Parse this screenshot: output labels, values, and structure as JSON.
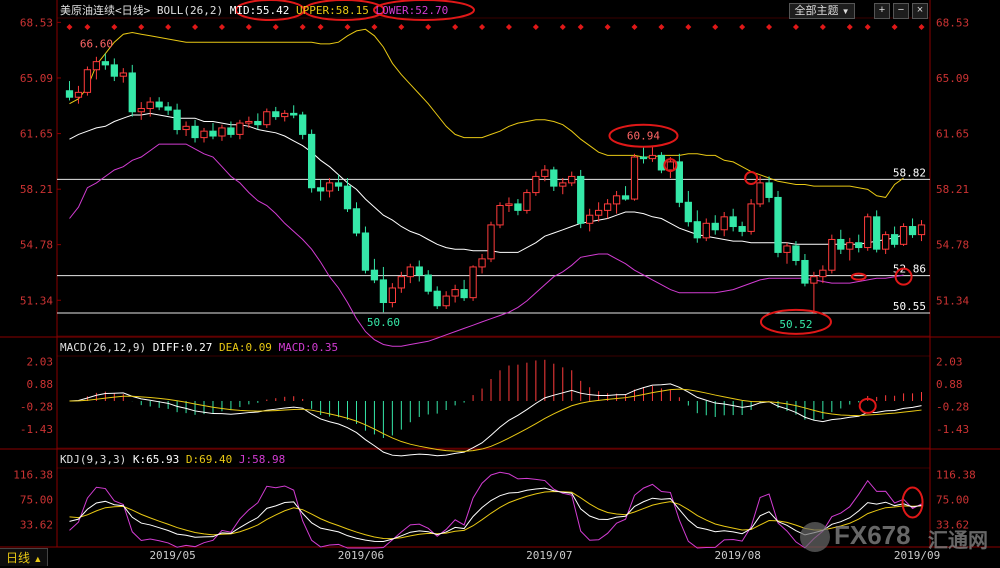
{
  "header": {
    "instrument": "美原油连续",
    "period": "<日线>",
    "boll_label": "BOLL(26,2)",
    "mid": "MID:55.42",
    "upper": "UPPER:58.15",
    "lower": "LOWER:52.70",
    "theme_button": "全部主题",
    "colors": {
      "mid": "#ffffff",
      "upper": "#e8c814",
      "lower": "#d23cd2"
    }
  },
  "bottom_bar": {
    "period_tab": "日线",
    "arrow": "▲"
  },
  "watermark": {
    "logo": "FX678",
    "cn": "汇通网"
  },
  "chart_data": [
    {
      "type": "candlestick",
      "name": "price",
      "ylim": [
        49.5,
        68.8
      ],
      "y_ticks": [
        "68.53",
        "65.09",
        "61.65",
        "58.21",
        "54.78",
        "51.34"
      ],
      "horizontal_lines": [
        {
          "value": 58.82,
          "label": "58.82"
        },
        {
          "value": 52.86,
          "label": "52.86"
        },
        {
          "value": 50.55,
          "label": "50.55"
        }
      ],
      "price_annotations": [
        "66.60",
        "60.94",
        "50.60",
        "50.52",
        "58.82"
      ],
      "x_labels": [
        "2019/05",
        "2019/06",
        "2019/07",
        "2019/08",
        "2019/09"
      ],
      "series": [
        {
          "name": "UPPER",
          "values": [
            63.5,
            63.8,
            64.5,
            65.9,
            66.6,
            67.3,
            67.8,
            67.9,
            67.8,
            67.7,
            67.6,
            67.5,
            67.4,
            67.3,
            67.3,
            67.3,
            67.3,
            67.3,
            67.3,
            67.3,
            67.3,
            67.3,
            67.3,
            67.3,
            67.3,
            67.3,
            67.3,
            67.3,
            67.2,
            67.2,
            67.3,
            67.7,
            68.0,
            68.1,
            67.7,
            67.0,
            66.0,
            65.3,
            64.7,
            64.1,
            63.5,
            62.8,
            62.1,
            61.6,
            61.4,
            61.4,
            61.4,
            61.6,
            61.8,
            62.1,
            62.3,
            62.4,
            62.5,
            62.5,
            62.4,
            62.2,
            61.8,
            61.3,
            60.9,
            60.5,
            60.3,
            60.3,
            60.3,
            60.3,
            60.2,
            60.2,
            60.3,
            60.3,
            60.3,
            60.4,
            60.4,
            60.3,
            60.3,
            60.0,
            59.9,
            59.6,
            59.3,
            59.1,
            58.9,
            58.7,
            58.6,
            58.5,
            58.5,
            58.4,
            58.4,
            58.4,
            58.4,
            58.4,
            58.3,
            58.2,
            57.8,
            57.7,
            58.5,
            58.9
          ]
        },
        {
          "name": "MID",
          "values": [
            61.3,
            61.6,
            61.8,
            62.0,
            62.1,
            62.4,
            62.6,
            62.8,
            62.8,
            62.9,
            62.8,
            62.7,
            62.6,
            62.6,
            62.6,
            62.4,
            62.4,
            62.3,
            62.2,
            62.2,
            62.1,
            61.9,
            61.8,
            61.7,
            61.5,
            61.2,
            60.9,
            60.5,
            60.0,
            59.6,
            59.1,
            58.6,
            58.2,
            57.6,
            57.1,
            56.6,
            56.3,
            55.9,
            55.6,
            55.4,
            55.1,
            54.8,
            54.6,
            54.5,
            54.5,
            54.4,
            54.4,
            54.4,
            54.3,
            54.3,
            54.3,
            54.6,
            54.9,
            55.3,
            55.5,
            55.7,
            55.9,
            56.1,
            56.2,
            56.3,
            56.4,
            56.6,
            56.8,
            56.8,
            56.7,
            56.5,
            56.4,
            56.1,
            55.8,
            55.6,
            55.4,
            55.3,
            55.2,
            55.1,
            55.0,
            55.0,
            54.9,
            54.9,
            54.9,
            54.9,
            54.9,
            54.8,
            54.8,
            54.8,
            54.8,
            54.8,
            54.8,
            54.8,
            54.8,
            54.9,
            55.0,
            55.1,
            55.2,
            55.4
          ]
        },
        {
          "name": "LOWER",
          "values": [
            56.4,
            57.1,
            58.3,
            58.6,
            59.0,
            59.4,
            59.6,
            60.0,
            60.2,
            60.6,
            61.0,
            61.0,
            61.0,
            61.0,
            60.7,
            60.4,
            60.2,
            59.6,
            59.0,
            58.6,
            58.0,
            57.5,
            57.2,
            56.7,
            56.1,
            55.6,
            55.1,
            54.5,
            53.7,
            52.8,
            52.1,
            51.2,
            50.2,
            49.4,
            48.9,
            48.6,
            48.5,
            48.5,
            48.6,
            48.7,
            48.8,
            49.0,
            49.2,
            49.4,
            49.6,
            49.8,
            50.0,
            50.2,
            50.4,
            50.6,
            50.9,
            51.3,
            51.8,
            52.3,
            52.8,
            53.1,
            53.5,
            54.0,
            54.1,
            54.2,
            54.2,
            53.9,
            53.6,
            53.2,
            52.9,
            52.6,
            52.3,
            52.0,
            51.8,
            51.8,
            51.8,
            51.8,
            51.8,
            51.9,
            52.0,
            52.2,
            52.4,
            52.6,
            52.7,
            52.7,
            52.7,
            52.7,
            52.7,
            52.6,
            52.5,
            52.4,
            52.4,
            52.4,
            52.5,
            52.6,
            52.7,
            52.7,
            52.8,
            52.9
          ]
        }
      ],
      "candles": [
        {
          "o": 64.3,
          "h": 64.9,
          "l": 63.7,
          "c": 63.9
        },
        {
          "o": 63.9,
          "h": 64.6,
          "l": 63.5,
          "c": 64.2
        },
        {
          "o": 64.2,
          "h": 65.8,
          "l": 64.0,
          "c": 65.6
        },
        {
          "o": 65.6,
          "h": 66.4,
          "l": 65.0,
          "c": 66.1
        },
        {
          "o": 66.1,
          "h": 66.6,
          "l": 65.6,
          "c": 65.9
        },
        {
          "o": 65.9,
          "h": 66.3,
          "l": 64.9,
          "c": 65.2
        },
        {
          "o": 65.2,
          "h": 65.7,
          "l": 64.8,
          "c": 65.4
        },
        {
          "o": 65.4,
          "h": 65.9,
          "l": 62.7,
          "c": 63.0
        },
        {
          "o": 63.0,
          "h": 63.6,
          "l": 62.5,
          "c": 63.2
        },
        {
          "o": 63.2,
          "h": 63.9,
          "l": 62.7,
          "c": 63.6
        },
        {
          "o": 63.6,
          "h": 63.9,
          "l": 63.1,
          "c": 63.3
        },
        {
          "o": 63.3,
          "h": 63.6,
          "l": 62.8,
          "c": 63.1
        },
        {
          "o": 63.1,
          "h": 63.5,
          "l": 61.6,
          "c": 61.9
        },
        {
          "o": 61.9,
          "h": 62.4,
          "l": 61.5,
          "c": 62.1
        },
        {
          "o": 62.1,
          "h": 62.5,
          "l": 61.1,
          "c": 61.4
        },
        {
          "o": 61.4,
          "h": 62.0,
          "l": 61.1,
          "c": 61.8
        },
        {
          "o": 61.8,
          "h": 62.3,
          "l": 61.3,
          "c": 61.5
        },
        {
          "o": 61.5,
          "h": 62.2,
          "l": 61.2,
          "c": 62.0
        },
        {
          "o": 62.0,
          "h": 62.4,
          "l": 61.4,
          "c": 61.6
        },
        {
          "o": 61.6,
          "h": 62.5,
          "l": 61.3,
          "c": 62.3
        },
        {
          "o": 62.3,
          "h": 62.7,
          "l": 62.0,
          "c": 62.4
        },
        {
          "o": 62.4,
          "h": 62.9,
          "l": 61.9,
          "c": 62.2
        },
        {
          "o": 62.2,
          "h": 63.2,
          "l": 62.0,
          "c": 63.0
        },
        {
          "o": 63.0,
          "h": 63.3,
          "l": 62.5,
          "c": 62.7
        },
        {
          "o": 62.7,
          "h": 63.1,
          "l": 62.4,
          "c": 62.9
        },
        {
          "o": 62.9,
          "h": 63.4,
          "l": 62.6,
          "c": 62.8
        },
        {
          "o": 62.8,
          "h": 63.0,
          "l": 61.3,
          "c": 61.6
        },
        {
          "o": 61.6,
          "h": 61.9,
          "l": 58.0,
          "c": 58.3
        },
        {
          "o": 58.3,
          "h": 58.8,
          "l": 57.5,
          "c": 58.1
        },
        {
          "o": 58.1,
          "h": 58.9,
          "l": 57.7,
          "c": 58.6
        },
        {
          "o": 58.6,
          "h": 59.1,
          "l": 58.1,
          "c": 58.4
        },
        {
          "o": 58.4,
          "h": 58.9,
          "l": 56.8,
          "c": 57.0
        },
        {
          "o": 57.0,
          "h": 57.4,
          "l": 55.3,
          "c": 55.5
        },
        {
          "o": 55.5,
          "h": 55.9,
          "l": 53.0,
          "c": 53.2
        },
        {
          "o": 53.2,
          "h": 53.9,
          "l": 52.4,
          "c": 52.6
        },
        {
          "o": 52.6,
          "h": 53.4,
          "l": 50.6,
          "c": 51.2
        },
        {
          "o": 51.2,
          "h": 52.4,
          "l": 50.9,
          "c": 52.1
        },
        {
          "o": 52.1,
          "h": 53.1,
          "l": 51.8,
          "c": 52.8
        },
        {
          "o": 52.8,
          "h": 53.6,
          "l": 52.4,
          "c": 53.4
        },
        {
          "o": 53.4,
          "h": 53.8,
          "l": 52.5,
          "c": 52.9
        },
        {
          "o": 52.9,
          "h": 53.2,
          "l": 51.7,
          "c": 51.9
        },
        {
          "o": 51.9,
          "h": 52.2,
          "l": 50.8,
          "c": 51.0
        },
        {
          "o": 51.0,
          "h": 51.9,
          "l": 50.8,
          "c": 51.6
        },
        {
          "o": 51.6,
          "h": 52.3,
          "l": 51.2,
          "c": 52.0
        },
        {
          "o": 52.0,
          "h": 52.6,
          "l": 51.3,
          "c": 51.5
        },
        {
          "o": 51.5,
          "h": 53.5,
          "l": 51.3,
          "c": 53.4
        },
        {
          "o": 53.4,
          "h": 54.2,
          "l": 53.0,
          "c": 53.9
        },
        {
          "o": 53.9,
          "h": 56.2,
          "l": 53.7,
          "c": 56.0
        },
        {
          "o": 56.0,
          "h": 57.4,
          "l": 55.8,
          "c": 57.2
        },
        {
          "o": 57.2,
          "h": 57.7,
          "l": 56.8,
          "c": 57.3
        },
        {
          "o": 57.3,
          "h": 57.6,
          "l": 56.6,
          "c": 56.9
        },
        {
          "o": 56.9,
          "h": 58.2,
          "l": 56.7,
          "c": 58.0
        },
        {
          "o": 58.0,
          "h": 59.3,
          "l": 57.8,
          "c": 59.0
        },
        {
          "o": 59.0,
          "h": 59.7,
          "l": 58.7,
          "c": 59.4
        },
        {
          "o": 59.4,
          "h": 59.6,
          "l": 58.1,
          "c": 58.4
        },
        {
          "o": 58.4,
          "h": 58.9,
          "l": 57.9,
          "c": 58.6
        },
        {
          "o": 58.6,
          "h": 59.3,
          "l": 58.4,
          "c": 59.0
        },
        {
          "o": 59.0,
          "h": 59.4,
          "l": 55.8,
          "c": 56.1
        },
        {
          "o": 56.1,
          "h": 57.0,
          "l": 55.6,
          "c": 56.6
        },
        {
          "o": 56.6,
          "h": 57.4,
          "l": 56.2,
          "c": 56.9
        },
        {
          "o": 56.9,
          "h": 57.6,
          "l": 56.4,
          "c": 57.3
        },
        {
          "o": 57.3,
          "h": 58.1,
          "l": 56.7,
          "c": 57.8
        },
        {
          "o": 57.8,
          "h": 58.4,
          "l": 57.5,
          "c": 57.6
        },
        {
          "o": 57.6,
          "h": 60.4,
          "l": 57.5,
          "c": 60.2
        },
        {
          "o": 60.2,
          "h": 60.8,
          "l": 59.8,
          "c": 60.1
        },
        {
          "o": 60.1,
          "h": 60.9,
          "l": 59.9,
          "c": 60.3
        },
        {
          "o": 60.3,
          "h": 60.5,
          "l": 59.2,
          "c": 59.4
        },
        {
          "o": 59.4,
          "h": 60.2,
          "l": 58.9,
          "c": 59.9
        },
        {
          "o": 59.9,
          "h": 60.4,
          "l": 57.1,
          "c": 57.4
        },
        {
          "o": 57.4,
          "h": 58.1,
          "l": 55.9,
          "c": 56.2
        },
        {
          "o": 56.2,
          "h": 56.9,
          "l": 54.9,
          "c": 55.2
        },
        {
          "o": 55.2,
          "h": 56.4,
          "l": 55.0,
          "c": 56.1
        },
        {
          "o": 56.1,
          "h": 56.6,
          "l": 55.4,
          "c": 55.7
        },
        {
          "o": 55.7,
          "h": 56.8,
          "l": 55.3,
          "c": 56.5
        },
        {
          "o": 56.5,
          "h": 57.0,
          "l": 55.6,
          "c": 55.9
        },
        {
          "o": 55.9,
          "h": 56.2,
          "l": 55.3,
          "c": 55.6
        },
        {
          "o": 55.6,
          "h": 57.6,
          "l": 55.4,
          "c": 57.3
        },
        {
          "o": 57.3,
          "h": 59.0,
          "l": 57.1,
          "c": 58.6
        },
        {
          "o": 58.6,
          "h": 59.0,
          "l": 57.4,
          "c": 57.7
        },
        {
          "o": 57.7,
          "h": 58.1,
          "l": 54.0,
          "c": 54.3
        },
        {
          "o": 54.3,
          "h": 54.9,
          "l": 53.6,
          "c": 54.7
        },
        {
          "o": 54.7,
          "h": 55.0,
          "l": 53.5,
          "c": 53.8
        },
        {
          "o": 53.8,
          "h": 54.2,
          "l": 52.2,
          "c": 52.4
        },
        {
          "o": 52.4,
          "h": 53.1,
          "l": 50.5,
          "c": 52.8
        },
        {
          "o": 52.8,
          "h": 53.5,
          "l": 52.4,
          "c": 53.2
        },
        {
          "o": 53.2,
          "h": 55.4,
          "l": 53.0,
          "c": 55.1
        },
        {
          "o": 55.1,
          "h": 55.7,
          "l": 54.2,
          "c": 54.5
        },
        {
          "o": 54.5,
          "h": 55.2,
          "l": 53.8,
          "c": 54.9
        },
        {
          "o": 54.9,
          "h": 55.4,
          "l": 54.3,
          "c": 54.6
        },
        {
          "o": 54.6,
          "h": 56.7,
          "l": 54.4,
          "c": 56.5
        },
        {
          "o": 56.5,
          "h": 56.9,
          "l": 54.3,
          "c": 54.5
        },
        {
          "o": 54.5,
          "h": 55.6,
          "l": 54.2,
          "c": 55.4
        },
        {
          "o": 55.4,
          "h": 55.9,
          "l": 54.6,
          "c": 54.8
        },
        {
          "o": 54.8,
          "h": 56.1,
          "l": 54.7,
          "c": 55.9
        },
        {
          "o": 55.9,
          "h": 56.4,
          "l": 55.2,
          "c": 55.4
        },
        {
          "o": 55.4,
          "h": 56.3,
          "l": 55.0,
          "c": 56.0
        }
      ]
    },
    {
      "type": "bar+line",
      "name": "MACD",
      "label": "MACD(26,12,9)",
      "diff_label": "DIFF:0.27",
      "dea_label": "DEA:0.09",
      "macd_label": "MACD:0.35",
      "ylim": [
        -2.2,
        2.3
      ],
      "y_ticks": [
        "2.03",
        "0.88",
        "-0.28",
        "-1.43"
      ]
    },
    {
      "type": "line",
      "name": "KDJ",
      "label": "KDJ(9,3,3)",
      "k_label": "K:65.93",
      "d_label": "D:69.40",
      "j_label": "J:58.98",
      "ylim": [
        0,
        130
      ],
      "y_ticks": [
        "116.38",
        "75.00",
        "33.62"
      ]
    }
  ]
}
